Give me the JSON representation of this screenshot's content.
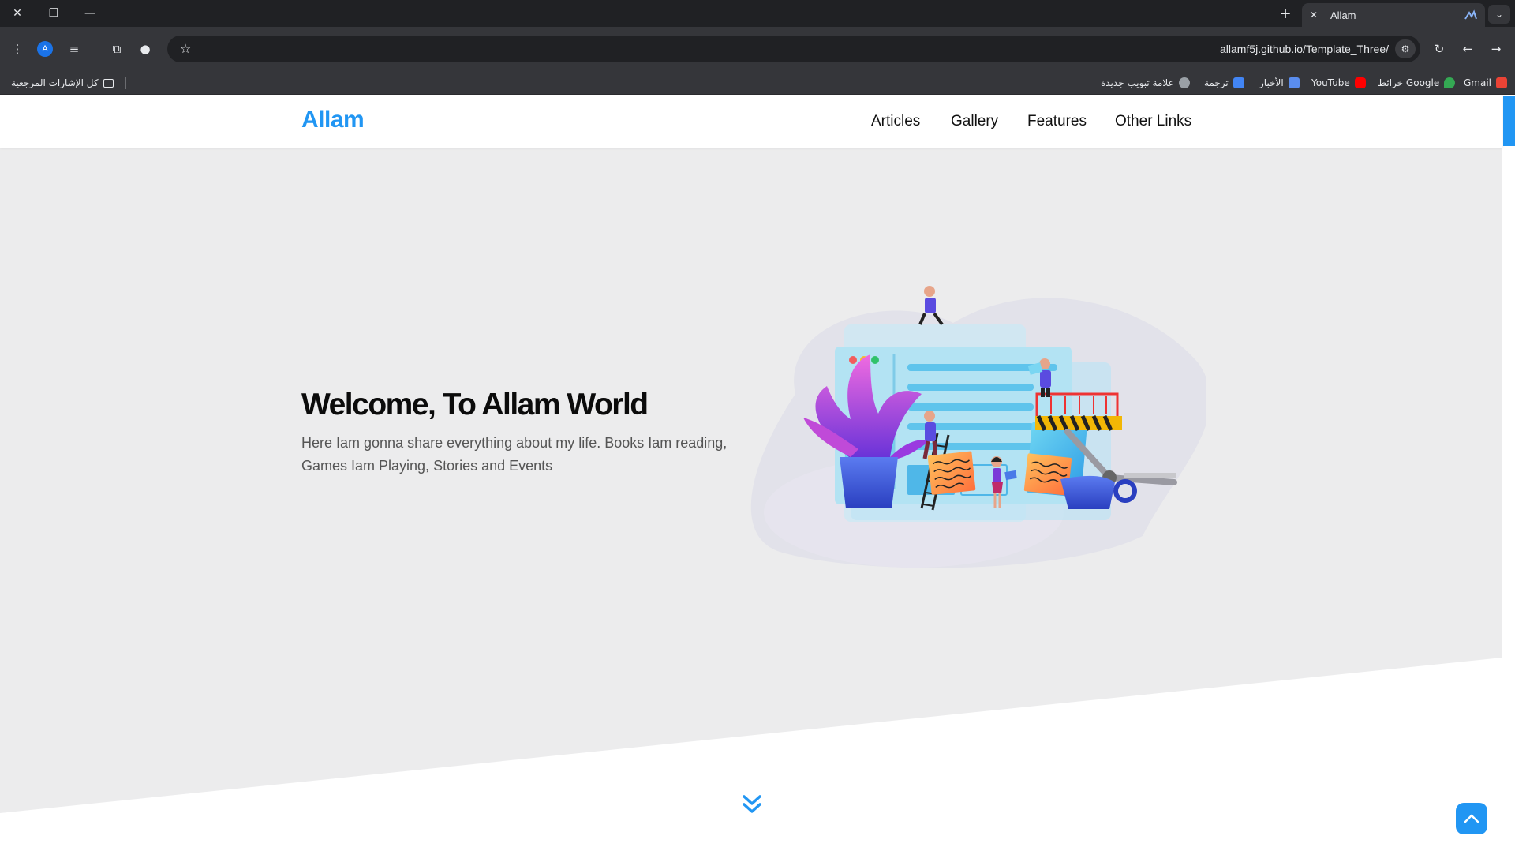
{
  "browser": {
    "tab_title": "Allam",
    "url": "allamf5j.github.io/Template_Three/",
    "avatar_letter": "A",
    "bookmarks": {
      "all_bookmarks": "كل الإشارات المرجعية",
      "new_tab": "علامة تبويب جديدة",
      "translate": "ترجمة",
      "news": "الأخبار",
      "youtube": "YouTube",
      "maps": "خرائط Google",
      "gmail": "Gmail"
    }
  },
  "site": {
    "logo": "Allam",
    "nav": {
      "articles": "Articles",
      "gallery": "Gallery",
      "features": "Features",
      "other_links": "Other Links"
    },
    "hero": {
      "title": "Welcome, To Allam World",
      "text": "Here Iam gonna share everything about my life. Books Iam reading, Games Iam Playing, Stories and Events"
    },
    "colors": {
      "accent": "#2196f3",
      "hero_background": "#ececed",
      "title": "#0b0b0b",
      "text": "#555555"
    }
  }
}
